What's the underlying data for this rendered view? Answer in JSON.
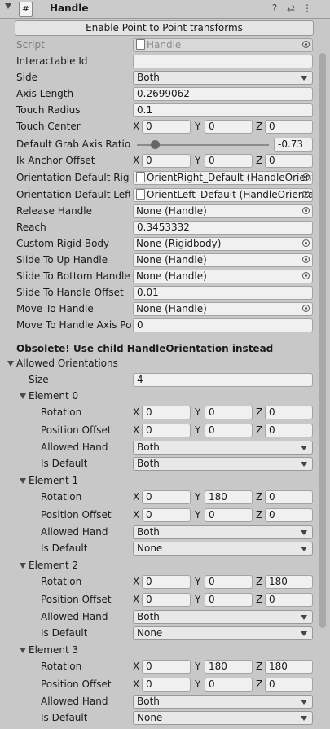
{
  "header": {
    "title": "Handle",
    "script_icon": "#"
  },
  "enable_button": "Enable Point to Point transforms",
  "script": {
    "label": "Script",
    "value": "Handle"
  },
  "fields": {
    "interactable_id": {
      "label": "Interactable Id",
      "value": ""
    },
    "side": {
      "label": "Side",
      "value": "Both"
    },
    "axis_length": {
      "label": "Axis Length",
      "value": "0.2699062"
    },
    "touch_radius": {
      "label": "Touch Radius",
      "value": "0.1"
    },
    "touch_center": {
      "label": "Touch Center",
      "x": "0",
      "y": "0",
      "z": "0"
    },
    "grab_axis_ratio": {
      "label": "Default Grab Axis Ratio",
      "value": "-0.73",
      "fraction": 0.135
    },
    "ik_anchor_offset": {
      "label": "Ik Anchor Offset",
      "x": "0",
      "y": "0",
      "z": "0"
    },
    "orientation_right": {
      "label": "Orientation Default Right",
      "value": "OrientRight_Default (HandleOrient"
    },
    "orientation_left": {
      "label": "Orientation Default Left",
      "value": "OrientLeft_Default (HandleOrienta"
    },
    "release_handle": {
      "label": "Release Handle",
      "value": "None (Handle)"
    },
    "reach": {
      "label": "Reach",
      "value": "0.3453332"
    },
    "custom_rigid_body": {
      "label": "Custom Rigid Body",
      "value": "None (Rigidbody)"
    },
    "slide_up": {
      "label": "Slide To Up Handle",
      "value": "None (Handle)"
    },
    "slide_bottom": {
      "label": "Slide To Bottom Handle",
      "value": "None (Handle)"
    },
    "slide_offset": {
      "label": "Slide To Handle Offset",
      "value": "0.01"
    },
    "move_to_handle": {
      "label": "Move To Handle",
      "value": "None (Handle)"
    },
    "move_axis_pos": {
      "label": "Move To Handle Axis Pos",
      "value": "0"
    }
  },
  "obsolete_text": "Obsolete! Use child HandleOrientation instead",
  "allowed": {
    "label": "Allowed Orientations",
    "size_label": "Size",
    "size": "4",
    "sub_labels": {
      "rotation": "Rotation",
      "position": "Position Offset",
      "hand": "Allowed Hand",
      "default": "Is Default"
    },
    "axes": {
      "x": "X",
      "y": "Y",
      "z": "Z"
    },
    "elements": [
      {
        "label": "Element 0",
        "rot": [
          "0",
          "0",
          "0"
        ],
        "pos": [
          "0",
          "0",
          "0"
        ],
        "hand": "Both",
        "is_default": "Both"
      },
      {
        "label": "Element 1",
        "rot": [
          "0",
          "180",
          "0"
        ],
        "pos": [
          "0",
          "0",
          "0"
        ],
        "hand": "Both",
        "is_default": "None"
      },
      {
        "label": "Element 2",
        "rot": [
          "0",
          "0",
          "180"
        ],
        "pos": [
          "0",
          "0",
          "0"
        ],
        "hand": "Both",
        "is_default": "None"
      },
      {
        "label": "Element 3",
        "rot": [
          "0",
          "180",
          "180"
        ],
        "pos": [
          "0",
          "0",
          "0"
        ],
        "hand": "Both",
        "is_default": "None"
      }
    ]
  },
  "icons": {
    "help": "help-icon",
    "settings": "sliders-icon",
    "menu": "kebab-menu-icon"
  }
}
